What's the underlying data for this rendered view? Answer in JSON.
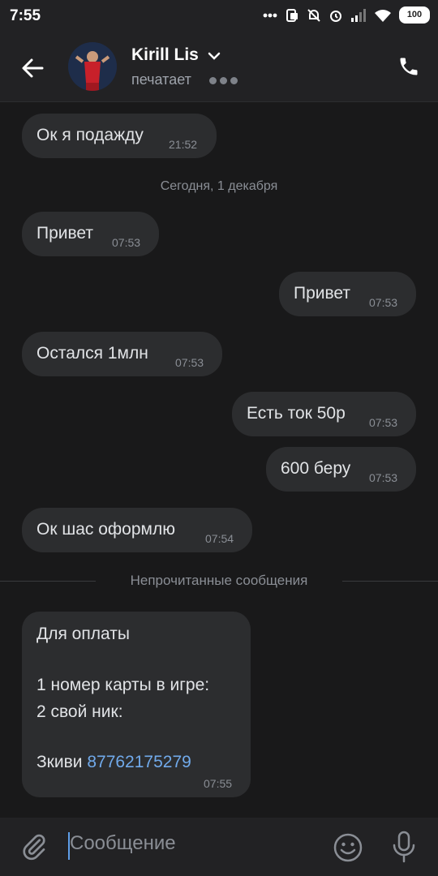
{
  "status_bar": {
    "time": "7:55",
    "battery": "100"
  },
  "header": {
    "name": "Kirill Lis",
    "status": "печатает"
  },
  "messages": [
    {
      "text": "Ок я подажду",
      "time": "21:52",
      "side": "in"
    },
    {
      "text": "Привет",
      "time": "07:53",
      "side": "in"
    },
    {
      "text": "Привет",
      "time": "07:53",
      "side": "out"
    },
    {
      "text": "Остался 1млн",
      "time": "07:53",
      "side": "in"
    },
    {
      "text": "Есть ток 50р",
      "time": "07:53",
      "side": "out"
    },
    {
      "text": "600 беру",
      "time": "07:53",
      "side": "out"
    },
    {
      "text": "Ок шас оформлю",
      "time": "07:54",
      "side": "in"
    }
  ],
  "date_separator": "Сегодня, 1 декабря",
  "unread_separator": "Непрочитанные сообщения",
  "last_message": {
    "line1": "Для оплаты",
    "line2": "1 номер карты в игре:",
    "line3": "2 свой ник:",
    "line4_prefix": "Зкиви",
    "line4_link": "87762175279",
    "time": "07:55"
  },
  "composer": {
    "placeholder": "Сообщение"
  },
  "colors": {
    "background": "#19191a",
    "bubble": "#2c2d2f",
    "link": "#71aaeb",
    "bar": "#222224"
  },
  "icons": [
    "back-arrow-icon",
    "chevron-down-icon",
    "phone-icon",
    "paperclip-icon",
    "smile-icon",
    "microphone-icon"
  ]
}
